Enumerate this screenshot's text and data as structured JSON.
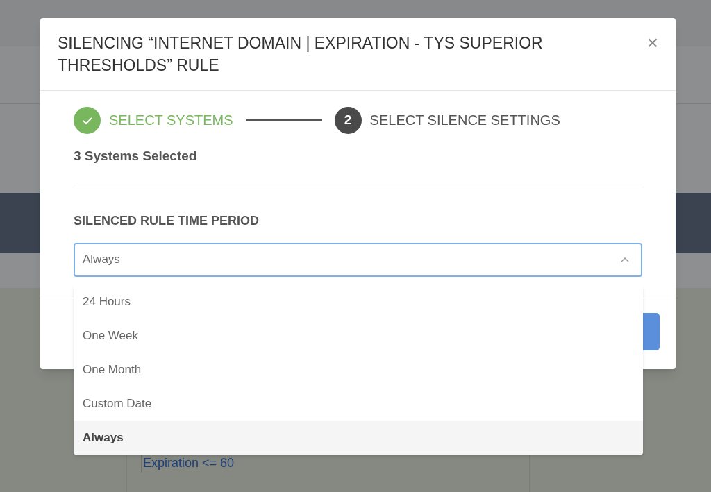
{
  "background": {
    "condition_text": "Expiration <= 60"
  },
  "dialog": {
    "title": "SILENCING “INTERNET DOMAIN | EXPIRATION - TYS SUPERIOR THRESHOLDS” RULE",
    "close": "×",
    "steps": [
      {
        "label": "SELECT SYSTEMS",
        "completed": true
      },
      {
        "label": "SELECT SILENCE SETTINGS",
        "number": "2",
        "completed": false
      }
    ],
    "summary": "3 Systems Selected",
    "field_label": "SILENCED RULE TIME PERIOD",
    "select": {
      "value": "Always",
      "expanded": true,
      "options": [
        {
          "label": "24 Hours",
          "selected": false
        },
        {
          "label": "One Week",
          "selected": false
        },
        {
          "label": "One Month",
          "selected": false
        },
        {
          "label": "Custom Date",
          "selected": false
        },
        {
          "label": "Always",
          "selected": true
        }
      ]
    }
  }
}
